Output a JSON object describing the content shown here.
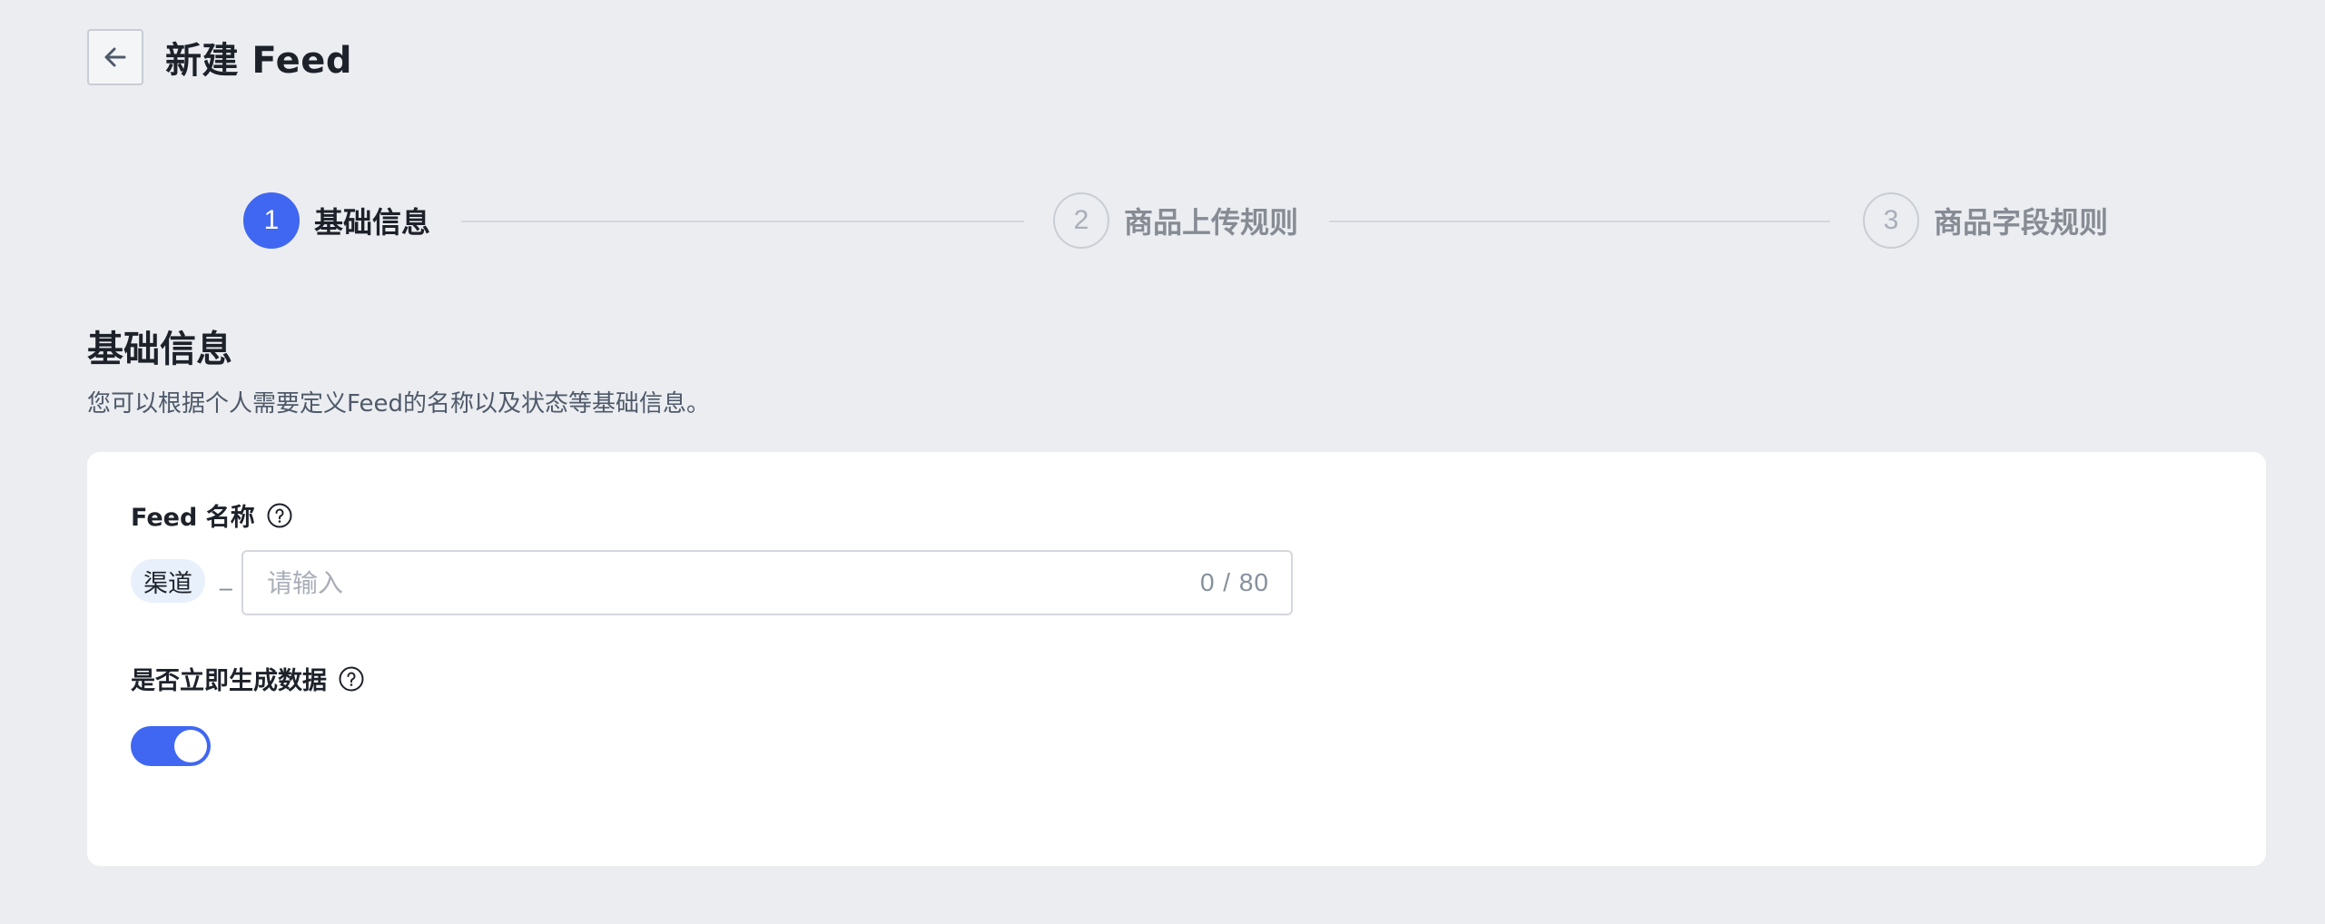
{
  "header": {
    "title": "新建 Feed"
  },
  "steps": [
    {
      "number": "1",
      "label": "基础信息",
      "state": "active"
    },
    {
      "number": "2",
      "label": "商品上传规则",
      "state": "inactive"
    },
    {
      "number": "3",
      "label": "商品字段规则",
      "state": "inactive"
    }
  ],
  "section": {
    "title": "基础信息",
    "description": "您可以根据个人需要定义Feed的名称以及状态等基础信息。"
  },
  "form": {
    "feed_name": {
      "label": "Feed 名称",
      "prefix_tag": "渠道",
      "separator": "_",
      "value": "",
      "placeholder": "请输入",
      "char_count": "0 / 80"
    },
    "generate_now": {
      "label": "是否立即生成数据",
      "enabled": true
    }
  },
  "colors": {
    "accent": "#4067f2",
    "background": "#ebedf1",
    "card": "#ffffff",
    "tag_background": "#e8f0fc"
  },
  "icons": {
    "back": "arrow-left-icon",
    "help": "question-circle-icon"
  }
}
